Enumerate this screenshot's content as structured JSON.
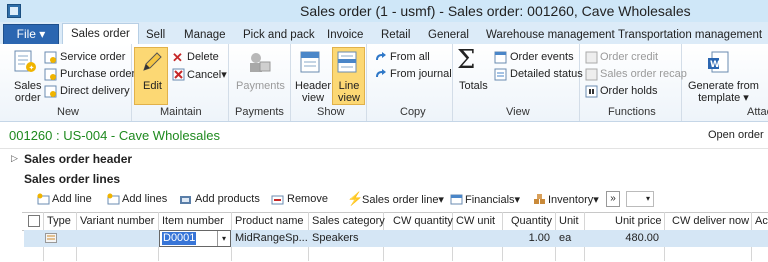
{
  "window": {
    "title": "Sales order (1 - usmf) - Sales order: 001260, Cave Wholesales"
  },
  "file_label": "File ▾",
  "tabs": [
    {
      "label": "Sales order",
      "active": true
    },
    {
      "label": "Sell"
    },
    {
      "label": "Manage"
    },
    {
      "label": "Pick and pack"
    },
    {
      "label": "Invoice"
    },
    {
      "label": "Retail"
    },
    {
      "label": "General"
    },
    {
      "label": "Warehouse management"
    },
    {
      "label": "Transportation management"
    }
  ],
  "ribbon": {
    "new": {
      "label": "New",
      "sales_order": [
        "Sales",
        "order"
      ],
      "service_order": "Service order",
      "purchase_order": "Purchase order",
      "direct_delivery": "Direct delivery"
    },
    "maintain": {
      "label": "Maintain",
      "edit": "Edit",
      "delete": "Delete",
      "cancel": "Cancel▾"
    },
    "payments": {
      "label": "Payments",
      "payments": "Payments"
    },
    "show": {
      "label": "Show",
      "header_view": [
        "Header",
        "view"
      ],
      "line_view": [
        "Line",
        "view"
      ]
    },
    "copy": {
      "label": "Copy",
      "from_all": "From all",
      "from_journal": "From journal"
    },
    "view": {
      "label": "View",
      "totals": "Totals",
      "order_events": "Order events",
      "detailed_status": "Detailed status"
    },
    "functions": {
      "label": "Functions",
      "order_credit": "Order credit",
      "sales_order_recap": "Sales order recap",
      "order_holds": "Order holds"
    },
    "attach": {
      "label": "Attac",
      "generate_from_template": [
        "Generate from",
        "template ▾"
      ]
    }
  },
  "info": {
    "id": "001260 : US-004 - Cave Wholesales",
    "open_order": "Open order"
  },
  "sections": {
    "header": "Sales order header",
    "lines": "Sales order lines"
  },
  "toolbar": {
    "add_line": "Add line",
    "add_lines": "Add lines",
    "add_products": "Add products",
    "remove": "Remove",
    "sales_order_line": "Sales order line▾",
    "financials": "Financials▾",
    "inventory": "Inventory▾",
    "more": "»"
  },
  "grid": {
    "columns": [
      "Type",
      "Variant number",
      "Item number",
      "Product name",
      "Sales category",
      "CW quantity",
      "CW unit",
      "Quantity",
      "Unit",
      "Unit price",
      "CW deliver now",
      "Ac"
    ],
    "rows": [
      {
        "item_number": "D0001",
        "product_name": "MidRangeSp...",
        "sales_category": "Speakers",
        "quantity": "1.00",
        "unit": "ea",
        "unit_price": "480.00"
      }
    ]
  },
  "colors": {
    "accent": "#2b66b1",
    "title_bar": "#cfe7f8",
    "highlight": "#fcd874",
    "id_green": "#1f8a1f",
    "selected_row": "#d5e6f5"
  }
}
